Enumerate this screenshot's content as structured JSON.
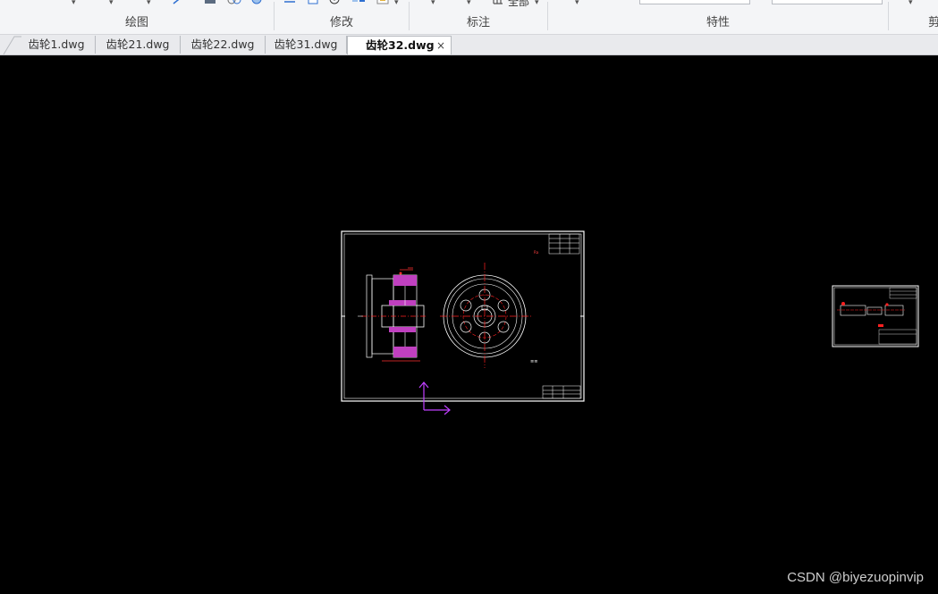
{
  "ribbon": {
    "groups": [
      {
        "label": "绘图"
      },
      {
        "label": "修改"
      },
      {
        "label": "标注"
      },
      {
        "label": "特性"
      },
      {
        "label": "剪"
      }
    ],
    "annotation_scale_text": "全部"
  },
  "tabs": [
    {
      "label": "齿轮1.dwg"
    },
    {
      "label": "齿轮21.dwg"
    },
    {
      "label": "齿轮22.dwg"
    },
    {
      "label": "齿轮31.dwg"
    },
    {
      "label": "齿轮32.dwg",
      "active": true
    }
  ],
  "tab_close": "×",
  "watermark": "CSDN @biyezuopinvip",
  "colors": {
    "canvas": "#000000",
    "drawing_lines": "#ffffff",
    "center_lines": "#ff2020",
    "hatch": "#c040c0",
    "ucs": "#c040ff"
  },
  "icons": [
    "line-icon",
    "hatch-icon",
    "region-icon",
    "mirror-icon",
    "move-icon",
    "copy-icon",
    "rotate-icon",
    "array-icon",
    "edit-icon",
    "scale-icon"
  ]
}
